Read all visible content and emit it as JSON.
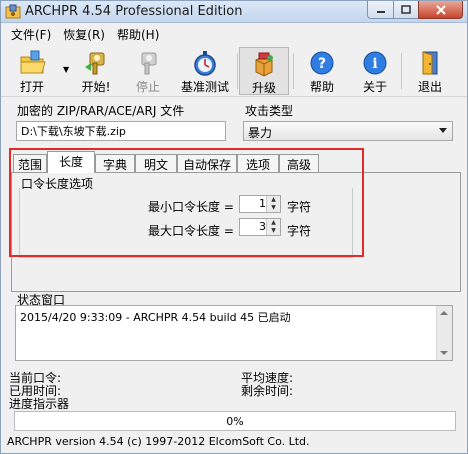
{
  "window": {
    "title": "ARCHPR 4.54 Professional Edition"
  },
  "menu": [
    {
      "label": "文件(F)"
    },
    {
      "label": "恢复(R)"
    },
    {
      "label": "帮助(H)"
    }
  ],
  "toolbar": {
    "open": "打开",
    "start": "开始!",
    "stop": "停止",
    "benchmark": "基准测试",
    "upgrade": "升级",
    "help": "帮助",
    "about": "关于",
    "exit": "退出"
  },
  "file_section": {
    "label": "加密的 ZIP/RAR/ACE/ARJ 文件",
    "value": "D:\\下载\\东坡下载.zip"
  },
  "attack": {
    "label": "攻击类型",
    "selected": "暴力"
  },
  "tabs": [
    {
      "label": "范围"
    },
    {
      "label": "长度",
      "active": true
    },
    {
      "label": "字典"
    },
    {
      "label": "明文"
    },
    {
      "label": "自动保存"
    },
    {
      "label": "选项"
    },
    {
      "label": "高级"
    }
  ],
  "length_options": {
    "group_title": "口令长度选项",
    "min_label": "最小口令长度 =",
    "min_value": "1",
    "max_label": "最大口令长度 =",
    "max_value": "3",
    "unit": "字符"
  },
  "status": {
    "title": "状态窗口",
    "lines": [
      "2015/4/20 9:33:09 - ARCHPR 4.54 build 45 已启动"
    ]
  },
  "info": {
    "current_password": "当前口令:",
    "elapsed_time": "已用时间:",
    "progress_indicator": "进度指示器",
    "average_speed": "平均速度:",
    "remaining_time": "剩余时间:"
  },
  "progress": {
    "text": "0%",
    "value": 0
  },
  "footer": {
    "text": "ARCHPR version 4.54 (c) 1997-2012 ElcomSoft Co. Ltd."
  }
}
